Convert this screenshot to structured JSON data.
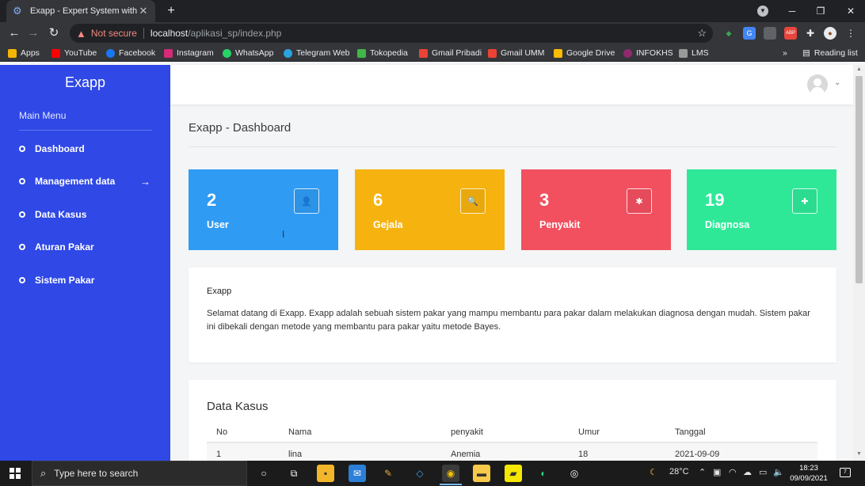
{
  "browser": {
    "tab_title": "Exapp - Expert System with Bayes",
    "new_tab": "+",
    "address": {
      "warning": "Not secure",
      "host": "localhost",
      "path": "/aplikasi_sp/index.php"
    },
    "bookmarks": [
      {
        "label": "Apps",
        "color": "#f4b400"
      },
      {
        "label": "YouTube",
        "color": "#ff0000"
      },
      {
        "label": "Facebook",
        "color": "#1877f2"
      },
      {
        "label": "Instagram",
        "color": "#d62976"
      },
      {
        "label": "WhatsApp",
        "color": "#25d366"
      },
      {
        "label": "Telegram Web",
        "color": "#2aa3e0"
      },
      {
        "label": "Tokopedia",
        "color": "#42b549"
      },
      {
        "label": "Gmail Pribadi",
        "color": "#ea4335"
      },
      {
        "label": "Gmail UMM",
        "color": "#ea4335"
      },
      {
        "label": "Google Drive",
        "color": "#fbbc04"
      },
      {
        "label": "INFOKHS",
        "color": "#8e2a6d"
      },
      {
        "label": "LMS",
        "color": "#999999"
      }
    ],
    "reading_list": "Reading list",
    "extensions": [
      {
        "name": "green-extension-icon",
        "color": "#34a853",
        "glyph": "◆"
      },
      {
        "name": "translate-extension-icon",
        "color": "#4285f4",
        "glyph": "G"
      },
      {
        "name": "puzzle-gray-extension-icon",
        "color": "#5f6368",
        "glyph": "■"
      },
      {
        "name": "adblock-extension-icon",
        "color": "#e8453c",
        "glyph": "ABP"
      },
      {
        "name": "extensions-icon",
        "color": "transparent",
        "glyph": "✚"
      }
    ]
  },
  "sidebar": {
    "brand": "Exapp",
    "menu_heading": "Main Menu",
    "items": [
      {
        "label": "Dashboard"
      },
      {
        "label": "Management data",
        "arrow": "→"
      },
      {
        "label": "Data Kasus"
      },
      {
        "label": "Aturan Pakar"
      },
      {
        "label": "Sistem Pakar"
      }
    ]
  },
  "header": {
    "page_title": "Exapp - Dashboard"
  },
  "cards": [
    {
      "count": "2",
      "label": "User",
      "color": "#2f9bf3",
      "icon": "user-icon",
      "glyph": "👤"
    },
    {
      "count": "6",
      "label": "Gejala",
      "color": "#f6b30f",
      "icon": "user-search-icon",
      "glyph": "🔍"
    },
    {
      "count": "3",
      "label": "Penyakit",
      "color": "#f2505f",
      "icon": "virus-icon",
      "glyph": "✱"
    },
    {
      "count": "19",
      "label": "Diagnosa",
      "color": "#2ee898",
      "icon": "medical-kit-icon",
      "glyph": "✚"
    }
  ],
  "intro": {
    "title": "Exapp",
    "text": "Selamat datang di Exapp. Exapp adalah sebuah sistem pakar yang mampu membantu para pakar dalam melakukan diagnosa dengan mudah. Sistem pakar ini dibekali dengan metode yang membantu para pakar yaitu metode Bayes."
  },
  "kasus": {
    "title": "Data Kasus",
    "columns": [
      "No",
      "Nama",
      "penyakit",
      "Umur",
      "Tanggal"
    ],
    "rows": [
      {
        "no": "1",
        "nama": "lina",
        "penyakit": "Anemia",
        "umur": "18",
        "tanggal": "2021-09-09"
      }
    ]
  },
  "taskbar": {
    "search_placeholder": "Type here to search",
    "weather": "28°C",
    "time": "18:23",
    "date": "09/09/2021",
    "notification_count": "7"
  }
}
